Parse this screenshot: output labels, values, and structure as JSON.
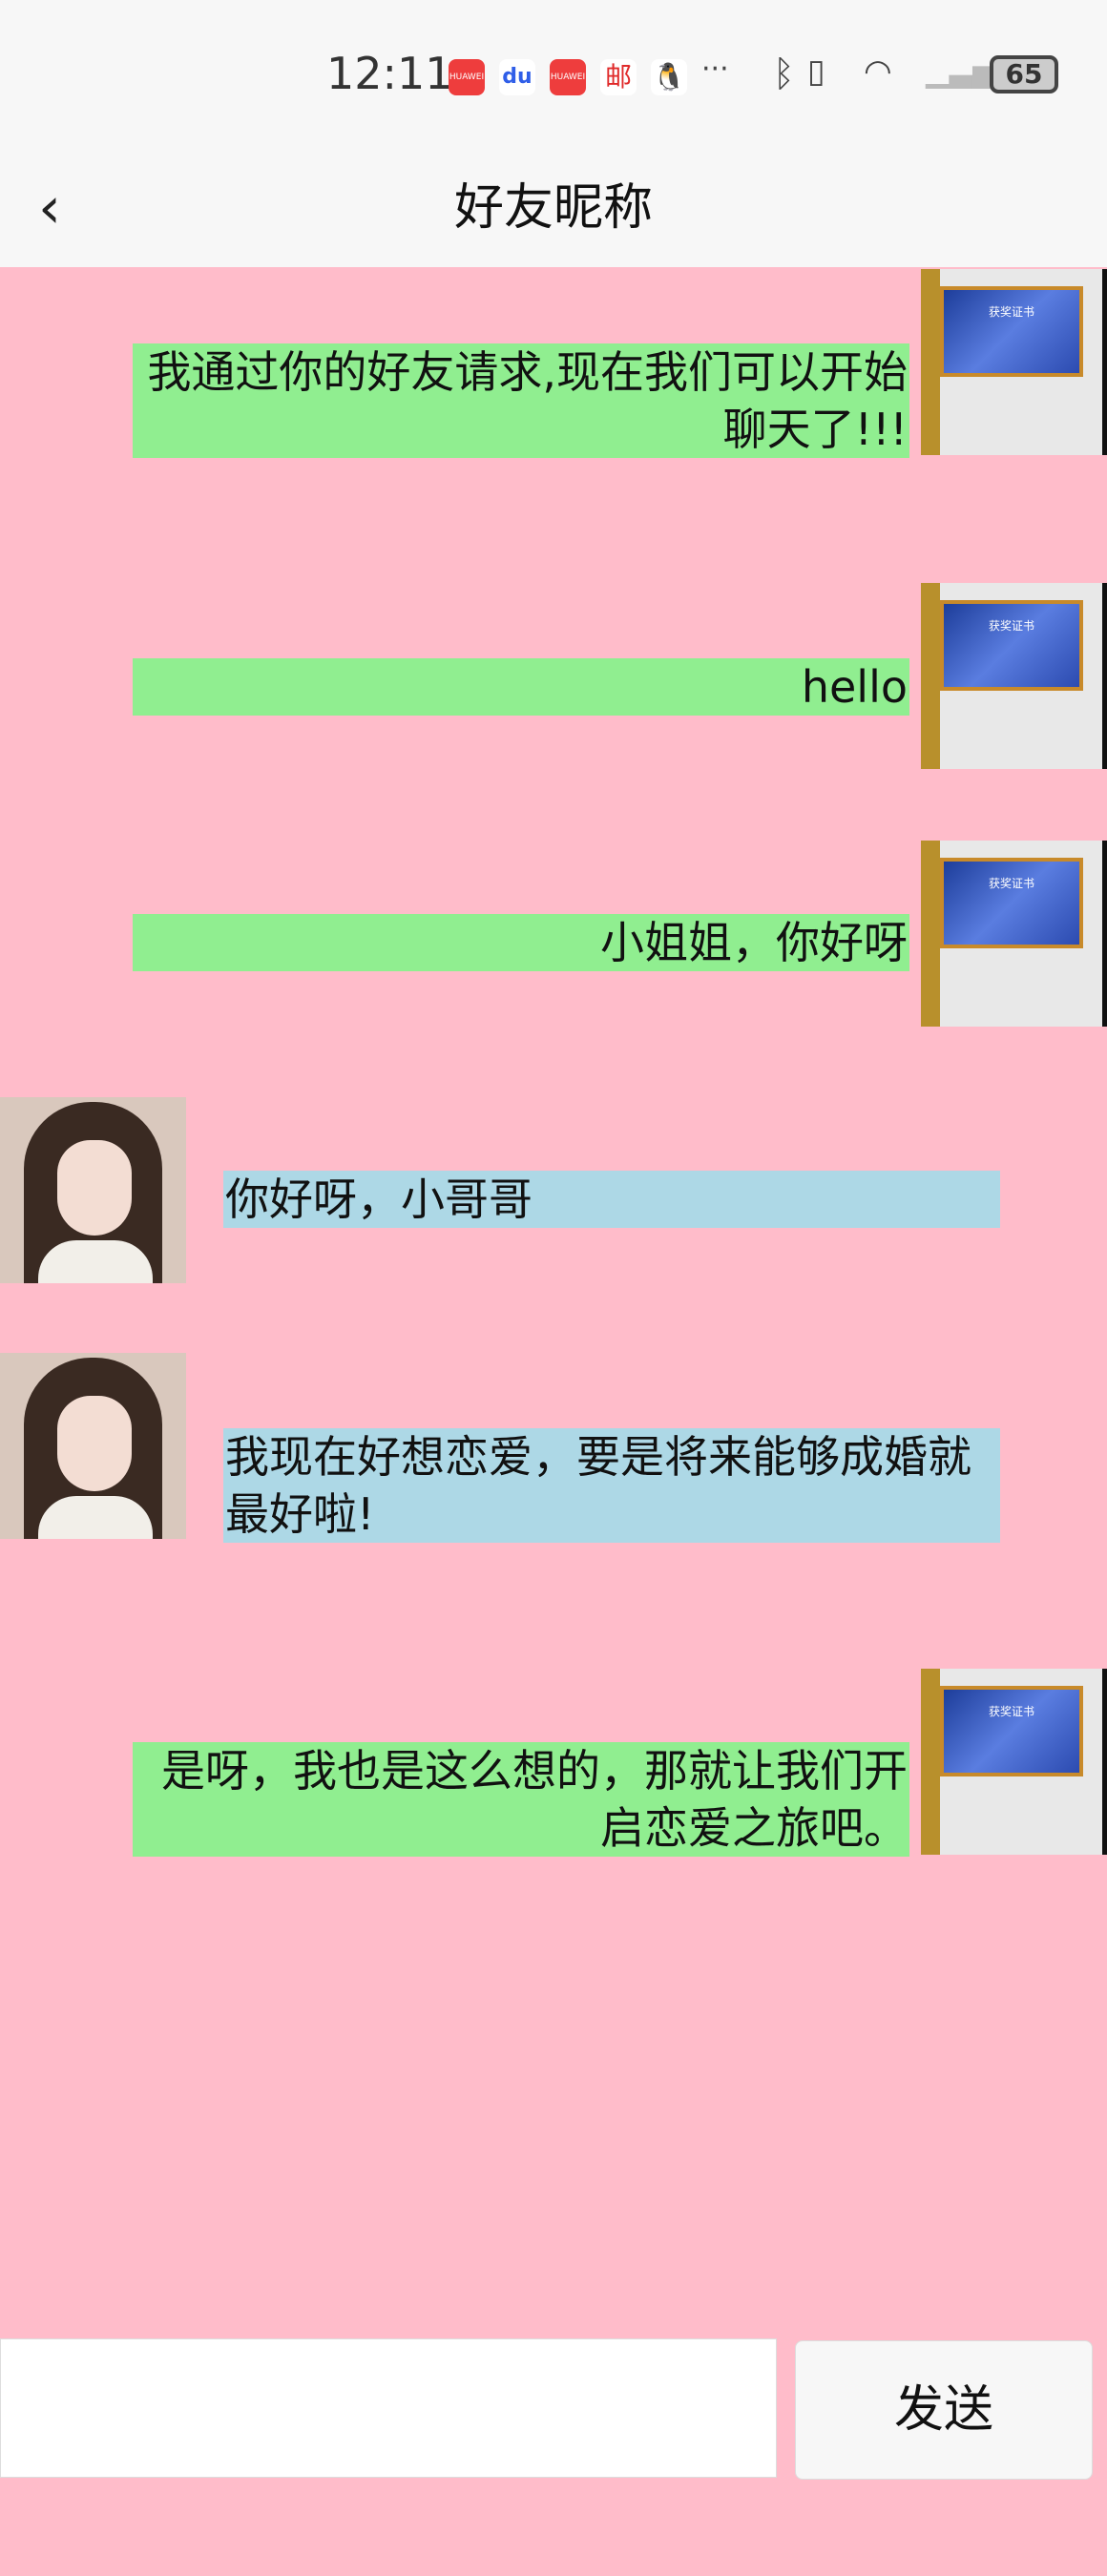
{
  "status_bar": {
    "time": "12:11",
    "battery": "65",
    "notification_icons": [
      "huawei-appgallery-icon",
      "baidu-icon",
      "huawei-appgallery-icon",
      "postal-icon",
      "qq-icon",
      "more-icon"
    ],
    "system_icons": [
      "bluetooth-icon",
      "vibrate-icon",
      "wifi-icon",
      "signal-icon"
    ],
    "huawei_label": "HUAWEI",
    "postal_label": "邮",
    "more": "···"
  },
  "header": {
    "title": "好友昵称",
    "back": "‹"
  },
  "messages": [
    {
      "side": "right",
      "text": "我通过你的好友请求,现在我们可以开始聊天了!!!"
    },
    {
      "side": "right",
      "text": "hello"
    },
    {
      "side": "right",
      "text": "小姐姐，你好呀"
    },
    {
      "side": "left",
      "text": "你好呀，小哥哥"
    },
    {
      "side": "left",
      "text": "我现在好想恋爱，要是将来能够成婚就最好啦!"
    },
    {
      "side": "right",
      "text": "是呀，我也是这么想的，那就让我们开启恋爱之旅吧。"
    }
  ],
  "my_avatar_caption": "获奖证书",
  "composer": {
    "input_value": "",
    "send_label": "发送"
  },
  "colors": {
    "background": "#ffbcca",
    "my_bubble": "#90ee90",
    "her_bubble": "#add8e6"
  }
}
